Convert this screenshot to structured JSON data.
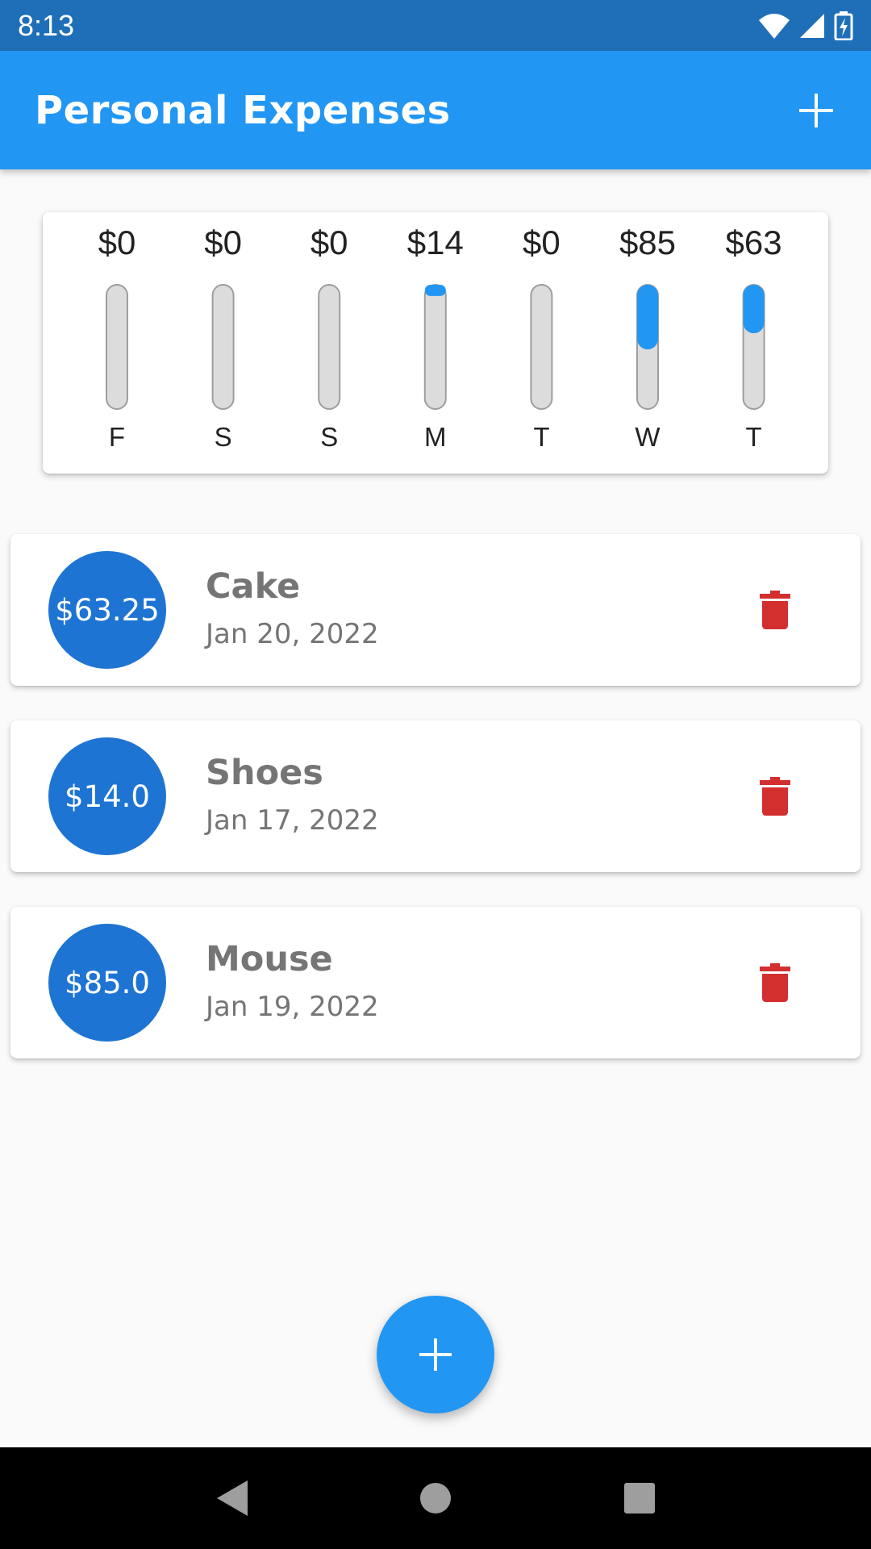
{
  "status_bar": {
    "time": "8:13",
    "icons": [
      "wifi-icon",
      "cellular-signal-icon",
      "battery-charging-icon"
    ]
  },
  "app_bar": {
    "title": "Personal Expenses",
    "add_icon": "plus-icon"
  },
  "chart_data": {
    "type": "bar",
    "categories": [
      "F",
      "S",
      "S",
      "M",
      "T",
      "W",
      "T"
    ],
    "amount_labels": [
      "$0",
      "$0",
      "$0",
      "$14",
      "$0",
      "$85",
      "$63"
    ],
    "values": [
      0,
      0,
      0,
      14,
      0,
      85,
      63
    ],
    "fill_fraction": [
      0,
      0,
      0,
      0.09,
      0,
      0.52,
      0.39
    ],
    "orientation": "vertical bars filled from top"
  },
  "expenses": [
    {
      "amount": "$63.25",
      "title": "Cake",
      "date": "Jan 20, 2022"
    },
    {
      "amount": "$14.0",
      "title": "Shoes",
      "date": "Jan 17, 2022"
    },
    {
      "amount": "$85.0",
      "title": "Mouse",
      "date": "Jan 19, 2022"
    }
  ],
  "fab": {
    "icon": "plus-icon"
  },
  "nav_bar": {
    "buttons": [
      "back-icon",
      "home-icon",
      "recents-icon"
    ]
  },
  "colors": {
    "status_bar": "#1e6fb8",
    "app_bar": "#2196f3",
    "circle": "#1e74d2",
    "bar_fill": "#2196f3",
    "bar_track": "#dcdcdc",
    "delete": "#d32f2f",
    "text_grey": "#757575"
  }
}
